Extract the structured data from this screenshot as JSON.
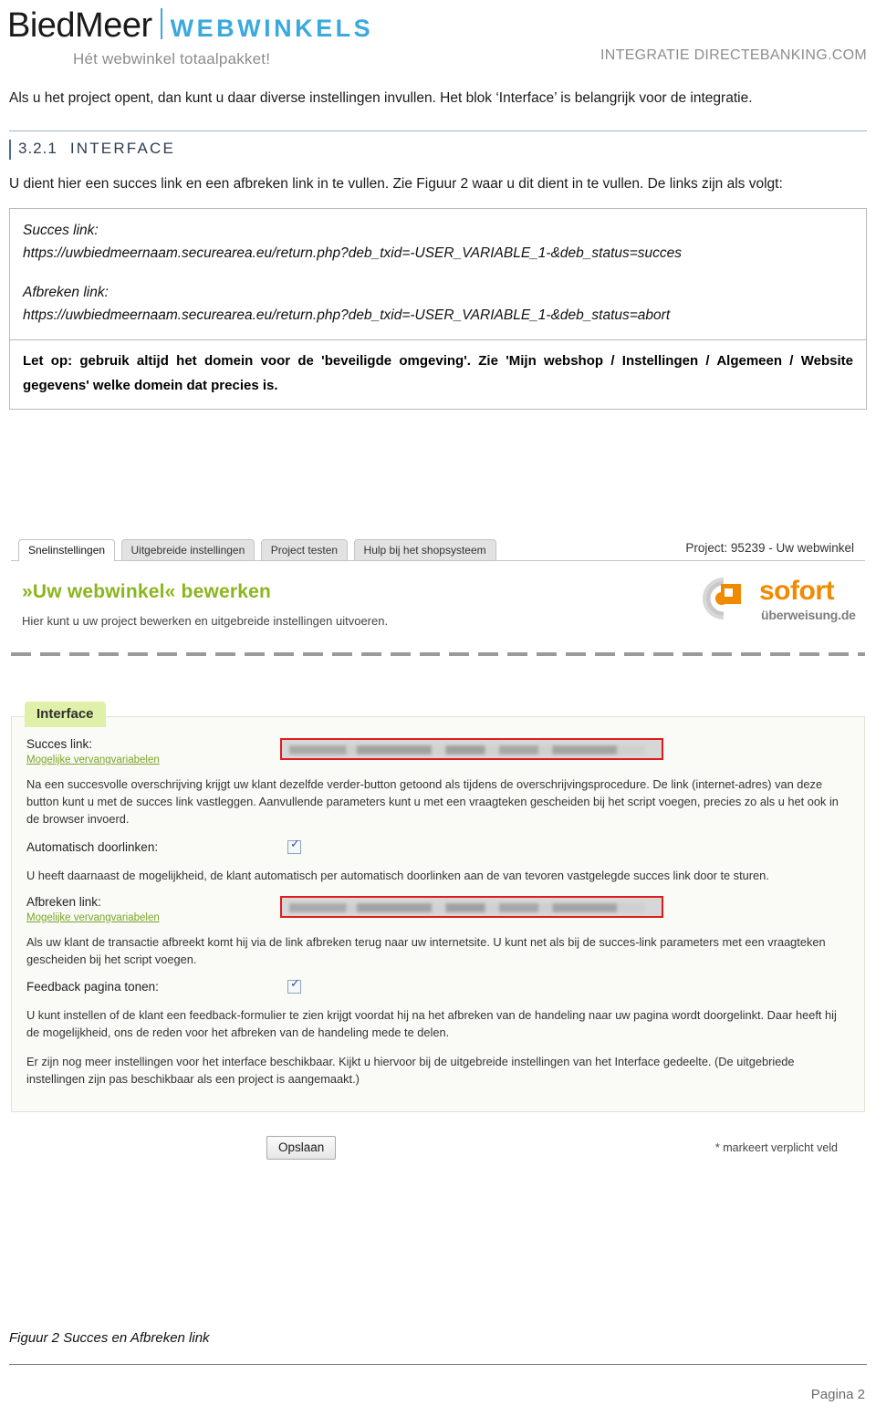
{
  "header": {
    "logo_primary": "BiedMeer",
    "logo_secondary": "WEBWINKELS",
    "tagline": "Hét webwinkel totaalpakket!",
    "right_label": "INTEGRATIE DIRECTEBANKING.COM",
    "accent_color": "#3aa9dd"
  },
  "doc": {
    "intro": "Als u het project opent, dan kunt u daar diverse instellingen invullen. Het blok ‘Interface’ is belangrijk voor de integratie.",
    "section": {
      "number": "3.2.1",
      "title": "INTERFACE"
    },
    "body": "U dient hier een succes link en een afbreken link in te vullen. Zie Figuur 2 waar u dit dient in te vullen. De links zijn als volgt:",
    "links": {
      "success_label": "Succes link:",
      "success_url": "https://uwbiedmeernaam.securearea.eu/return.php?deb_txid=-USER_VARIABLE_1-&deb_status=succes",
      "abort_label": "Afbreken link:",
      "abort_url": "https://uwbiedmeernaam.securearea.eu/return.php?deb_txid=-USER_VARIABLE_1-&deb_status=abort"
    },
    "notice": "Let op: gebruik altijd het domein voor de 'beveiligde omgeving'. Zie 'Mijn webshop / Instellingen / Algemeen / Website gegevens' welke domein dat precies is."
  },
  "screenshot": {
    "tabs": [
      {
        "label": "Snelinstellingen",
        "active": true
      },
      {
        "label": "Uitgebreide instellingen",
        "active": false
      },
      {
        "label": "Project testen",
        "active": false
      },
      {
        "label": "Hulp bij het shopsysteem",
        "active": false
      }
    ],
    "project_label": "Project: 95239 - Uw webwinkel",
    "title": "»Uw webwinkel« bewerken",
    "subtitle": "Hier kunt u uw project bewerken en uitgebreide instellingen uitvoeren.",
    "brand_logo": {
      "word": "sofort",
      "sub": "überweisung.de",
      "color": "#f08a00"
    },
    "fieldset": {
      "legend": "Interface",
      "success": {
        "label": "Succes link:",
        "sublink": "Mogelijke vervangvariabelen",
        "input_value": "",
        "help": "Na een succesvolle overschrijving krijgt uw klant dezelfde verder-button getoond als tijdens de overschrijvingsprocedure. De link (internet-adres) van deze button kunt u met de succes link vastleggen. Aanvullende parameters kunt u met een vraagteken gescheiden bij het script voegen, precies zo als u het ook in de browser invoerd."
      },
      "auto_forward": {
        "label": "Automatisch doorlinken:",
        "checked": true,
        "help": "U heeft daarnaast de mogelijkheid, de klant automatisch per automatisch doorlinken aan de van tevoren vastgelegde succes link door te sturen."
      },
      "abort": {
        "label": "Afbreken link:",
        "sublink": "Mogelijke vervangvariabelen",
        "input_value": "",
        "help": "Als uw klant de transactie afbreekt komt hij via de link afbreken terug naar uw internetsite. U kunt net als bij de succes-link parameters met een vraagteken gescheiden bij het script voegen."
      },
      "feedback": {
        "label": "Feedback pagina tonen:",
        "checked": true,
        "help": "U kunt instellen of de klant een feedback-formulier te zien krijgt voordat hij na het afbreken van de handeling naar uw pagina wordt doorgelinkt. Daar heeft hij de mogelijkheid, ons de reden voor het afbreken van de handeling mede te delen.",
        "help2": "Er zijn nog meer instellingen voor het interface beschikbaar. Kijkt u hiervoor bij de uitgebreide instellingen van het Interface gedeelte. (De uitgebriede instellingen zijn pas beschikbaar als een project is aangemaakt.)"
      }
    },
    "save_button": "Opslaan",
    "required_note": "* markeert verplicht veld",
    "checkmark_glyph": "✓"
  },
  "caption": "Figuur 2 Succes en Afbreken link",
  "page_number": "Pagina 2"
}
